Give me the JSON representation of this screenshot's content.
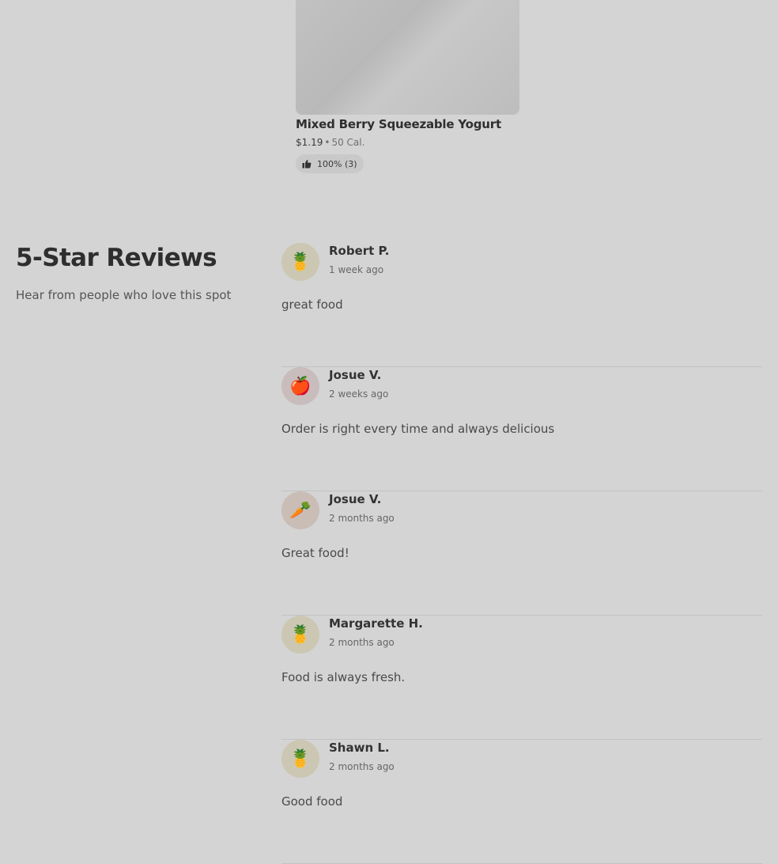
{
  "product": {
    "name": "Mixed Berry Squeezable Yogurt",
    "price": "$1.19",
    "separator": "•",
    "calories": "50 Cal.",
    "rating": "100% (3)",
    "rating_icon": "thumbs-up-icon"
  },
  "reviews_section": {
    "title": "5-Star Reviews",
    "subtitle": "Hear from people who love this spot"
  },
  "reviews": [
    {
      "name": "Robert P.",
      "time": "1 week ago",
      "text": "great food",
      "avatar_icon": "pineapple-icon",
      "avatar_glyph": "🍍"
    },
    {
      "name": "Josue V.",
      "time": "2 weeks ago",
      "text": "Order is right every time and always delicious",
      "avatar_icon": "apple-icon",
      "avatar_glyph": "🍎"
    },
    {
      "name": "Josue V.",
      "time": "2 months ago",
      "text": "Great food!",
      "avatar_icon": "carrot-icon",
      "avatar_glyph": "🥕"
    },
    {
      "name": "Margarette H.",
      "time": "2 months ago",
      "text": "Food is always fresh.",
      "avatar_icon": "pineapple-icon",
      "avatar_glyph": "🍍"
    },
    {
      "name": "Shawn L.",
      "time": "2 months ago",
      "text": "Good food",
      "avatar_icon": "pineapple-icon",
      "avatar_glyph": "🍍"
    }
  ]
}
